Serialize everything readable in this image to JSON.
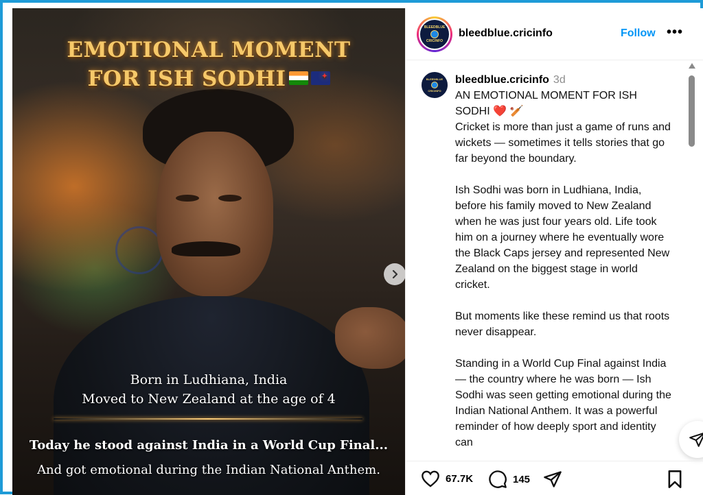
{
  "post_image": {
    "headline_line1": "EMOTIONAL MOMENT",
    "headline_line2": "FOR ISH SODHI",
    "caption_line1": "Born in Ludhiana, India",
    "caption_line2": "Moved to New Zealand at the age of 4",
    "caption_line3": "Today he stood against India in a World Cup Final...",
    "caption_line4": "And got emotional during the Indian National Anthem.",
    "next_icon": "chevron-right-icon"
  },
  "header": {
    "username": "bleedblue.cricinfo",
    "follow_label": "Follow",
    "more_label": "•••",
    "avatar_text_top": "BLEEDBLUE",
    "avatar_text_bottom": "CRICINFO"
  },
  "caption": {
    "username": "bleedblue.cricinfo",
    "time": "3d",
    "title": "AN EMOTIONAL MOMENT FOR ISH SODHI",
    "title_emojis": "❤️ 🏏",
    "paragraphs": [
      "Cricket is more than just a game of runs and wickets — sometimes it tells stories that go far beyond the boundary.",
      "Ish Sodhi was born in Ludhiana, India, before his family moved to New Zealand when he was just four years old. Life took him on a journey where he eventually wore the Black Caps jersey and represented New Zealand on the biggest stage in world cricket.",
      "But moments like these remind us that roots never disappear.",
      "Standing in a World Cup Final against India — the country where he was born — Ish Sodhi was seen getting emotional during the Indian National Anthem. It was a powerful reminder of how deeply sport and identity can"
    ]
  },
  "actions": {
    "likes": "67.7K",
    "comments": "145",
    "like_icon": "heart-icon",
    "comment_icon": "comment-icon",
    "share_icon": "send-icon",
    "save_icon": "bookmark-icon"
  },
  "colors": {
    "accent": "#0095f6",
    "frame": "#1e9bd7",
    "headline": "#f6c96a"
  }
}
